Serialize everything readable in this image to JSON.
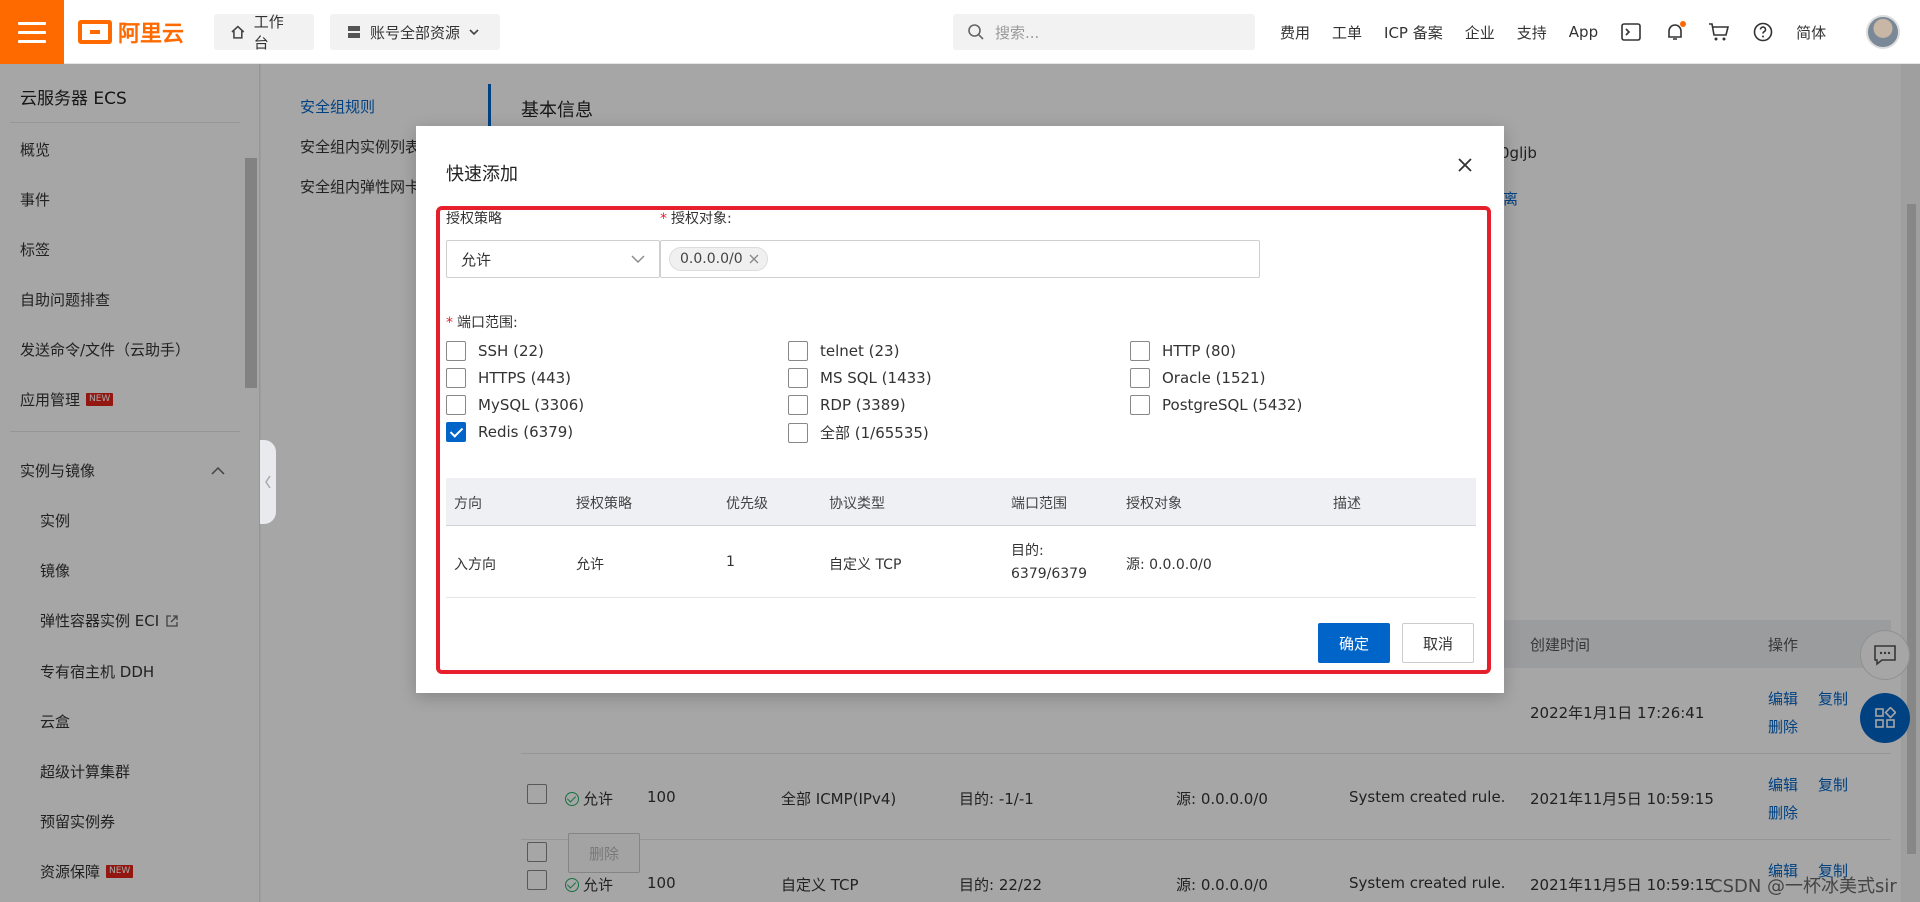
{
  "topbar": {
    "brand": "阿里云",
    "workbench": "工作台",
    "resources": "账号全部资源",
    "search_placeholder": "搜索...",
    "links": [
      "费用",
      "工单",
      "ICP 备案",
      "企业",
      "支持",
      "App"
    ],
    "lang": "简体"
  },
  "sidebar": {
    "title": "云服务器 ECS",
    "items": [
      "概览",
      "事件",
      "标签",
      "自助问题排查",
      "发送命令/文件（云助手）",
      "应用管理"
    ],
    "group": "实例与镜像",
    "sub_items": [
      "实例",
      "镜像",
      "弹性容器实例 ECI",
      "专有宿主机 DDH",
      "云盒",
      "超级计算集群",
      "预留实例券",
      "资源保障"
    ],
    "new_badge": "NEW"
  },
  "subnav": {
    "items": [
      "安全组规则",
      "安全组内实例列表",
      "安全组内弹性网卡"
    ]
  },
  "main": {
    "title": "基本信息",
    "peek_id": "0gljb",
    "peek_link": "离",
    "table_headers": [
      "创建时间",
      "操作"
    ],
    "rows": [
      {
        "time": "2022年1月1日 17:26:41",
        "actions": [
          "编辑",
          "复制",
          "删除"
        ]
      },
      {
        "policy": "允许",
        "priority": "100",
        "protocol": "全部 ICMP(IPv4)",
        "port": "目的: -1/-1",
        "source": "源: 0.0.0.0/0",
        "desc": "System created rule.",
        "time": "2021年11月5日 10:59:15",
        "actions": [
          "编辑",
          "复制",
          "删除"
        ]
      },
      {
        "policy": "允许",
        "priority": "100",
        "protocol": "自定义 TCP",
        "port": "目的: 22/22",
        "source": "源: 0.0.0.0/0",
        "desc": "System created rule.",
        "time": "2021年11月5日 10:59:15",
        "actions": [
          "编辑",
          "复制"
        ]
      }
    ],
    "delete_btn": "删除"
  },
  "watermark": "CSDN @一杯冰美式sir",
  "dialog": {
    "title": "快速添加",
    "policy_label": "授权策略",
    "policy_value": "允许",
    "target_label": "授权对象:",
    "target_tag": "0.0.0.0/0",
    "port_label": "端口范围:",
    "ports": [
      {
        "label": "SSH (22)",
        "checked": false
      },
      {
        "label": "telnet (23)",
        "checked": false
      },
      {
        "label": "HTTP (80)",
        "checked": false
      },
      {
        "label": "HTTPS (443)",
        "checked": false
      },
      {
        "label": "MS SQL (1433)",
        "checked": false
      },
      {
        "label": "Oracle (1521)",
        "checked": false
      },
      {
        "label": "MySQL (3306)",
        "checked": false
      },
      {
        "label": "RDP (3389)",
        "checked": false
      },
      {
        "label": "PostgreSQL (5432)",
        "checked": false
      },
      {
        "label": "Redis (6379)",
        "checked": true
      },
      {
        "label": "全部 (1/65535)",
        "checked": false
      }
    ],
    "table": {
      "headers": [
        "方向",
        "授权策略",
        "优先级",
        "协议类型",
        "端口范围",
        "授权对象",
        "描述"
      ],
      "row": {
        "direction": "入方向",
        "policy": "允许",
        "priority": "1",
        "protocol": "自定义 TCP",
        "port": "目的: 6379/6379",
        "target": "源: 0.0.0.0/0",
        "desc": ""
      }
    },
    "ok": "确定",
    "cancel": "取消"
  },
  "colors": {
    "brand": "#ff6a00",
    "primary": "#0064c8",
    "highlight": "#e5202a"
  }
}
